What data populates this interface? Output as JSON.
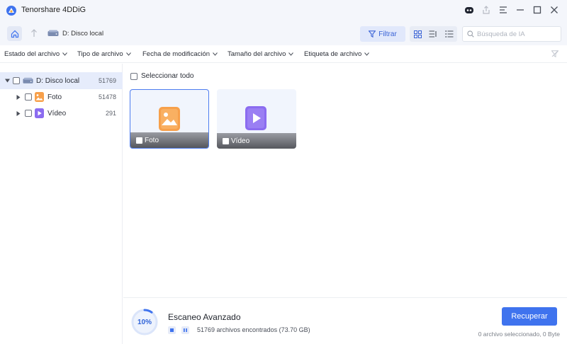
{
  "app": {
    "title": "Tenorshare 4DDiG",
    "brand_color": "#3f73ee"
  },
  "window_controls": [
    "robot-icon",
    "share-icon",
    "menu-icon",
    "minimize-icon",
    "maximize-icon",
    "close-icon"
  ],
  "nav": {
    "breadcrumb_label": "D: Disco local",
    "filter_label": "Filtrar",
    "search_placeholder": "Búsqueda de IA"
  },
  "filterbar": {
    "items": [
      "Estado del archivo",
      "Tipo de archivo",
      "Fecha de modificación",
      "Tamaño del archivo",
      "Etiqueta de archivo"
    ]
  },
  "sidebar": {
    "items": [
      {
        "label": "D: Disco local",
        "count": "51769",
        "icon": "drive-icon",
        "selected": true
      },
      {
        "label": "Foto",
        "count": "51478",
        "icon": "photo-icon",
        "selected": false
      },
      {
        "label": "Vídeo",
        "count": "291",
        "icon": "video-icon",
        "selected": false
      }
    ]
  },
  "main": {
    "select_all_label": "Seleccionar todo",
    "cards": [
      {
        "label": "Foto",
        "icon": "photo-icon",
        "color": "#f7a04b"
      },
      {
        "label": "Vídeo",
        "icon": "video-icon",
        "color": "#8b6cf0"
      }
    ]
  },
  "bottom": {
    "progress_label": "10%",
    "progress_fraction": 0.1,
    "scan_title": "Escaneo Avanzado",
    "found_text": "51769 archivos encontrados (73.70 GB)",
    "recover_label": "Recuperar",
    "selection_text": "0 archivo seleccionado, 0 Byte"
  }
}
